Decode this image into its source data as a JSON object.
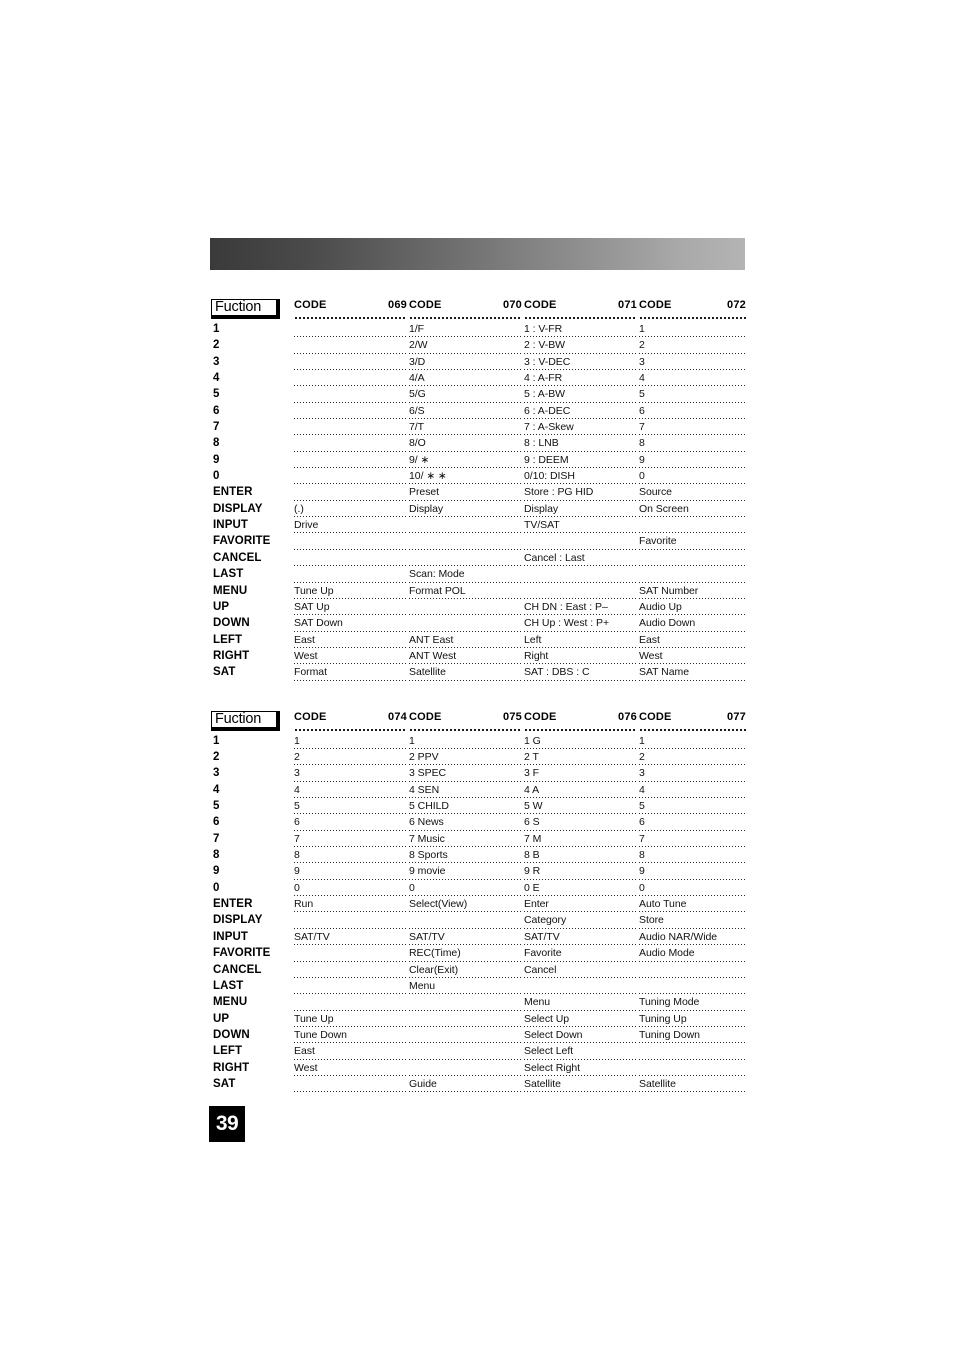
{
  "page": {
    "number": "39"
  },
  "banner": {
    "gradient_from": "#3a3a3a",
    "gradient_to": "#b4b4b4"
  },
  "tables": [
    {
      "fuction_label": "Fuction",
      "code_label": "CODE",
      "codes": [
        "069",
        "070",
        "071",
        "072"
      ],
      "functions": [
        "1",
        "2",
        "3",
        "4",
        "5",
        "6",
        "7",
        "8",
        "9",
        "0",
        "ENTER",
        "DISPLAY",
        "INPUT",
        "FAVORITE",
        "CANCEL",
        "LAST",
        "MENU",
        "UP",
        "DOWN",
        "LEFT",
        "RIGHT",
        "SAT"
      ],
      "columns": [
        [
          "",
          "",
          "",
          "",
          "",
          "",
          "",
          "",
          "",
          "",
          "",
          "(.)",
          "Drive",
          "",
          "",
          "",
          "Tune Up",
          "SAT Up",
          "SAT Down",
          "East",
          "West",
          "Format"
        ],
        [
          "1/F",
          "2/W",
          "3/D",
          "4/A",
          "5/G",
          "6/S",
          "7/T",
          "8/O",
          "9/ ∗",
          "10/ ∗ ∗",
          "Preset",
          "Display",
          "",
          "",
          "",
          "Scan: Mode",
          "Format POL",
          "",
          "",
          "ANT East",
          "ANT West",
          "Satellite"
        ],
        [
          "1 : V-FR",
          "2 : V-BW",
          "3 : V-DEC",
          "4 : A-FR",
          "5 : A-BW",
          "6 : A-DEC",
          "7 : A-Skew",
          "8 : LNB",
          "9 : DEEM",
          "0/10: DISH",
          "Store : PG HID",
          "Display",
          "TV/SAT",
          "",
          "Cancel : Last",
          "",
          "",
          "CH DN : East : P–",
          "CH Up : West : P+",
          "Left",
          "Right",
          "SAT : DBS : C"
        ],
        [
          "1",
          "2",
          "3",
          "4",
          "5",
          "6",
          "7",
          "8",
          "9",
          "0",
          "Source",
          "On Screen",
          "",
          "Favorite",
          "",
          "",
          "SAT Number",
          "Audio Up",
          "Audio Down",
          "East",
          "West",
          "SAT Name"
        ]
      ]
    },
    {
      "fuction_label": "Fuction",
      "code_label": "CODE",
      "codes": [
        "074",
        "075",
        "076",
        "077"
      ],
      "functions": [
        "1",
        "2",
        "3",
        "4",
        "5",
        "6",
        "7",
        "8",
        "9",
        "0",
        "ENTER",
        "DISPLAY",
        "INPUT",
        "FAVORITE",
        "CANCEL",
        "LAST",
        "MENU",
        "UP",
        "DOWN",
        "LEFT",
        "RIGHT",
        "SAT"
      ],
      "columns": [
        [
          "1",
          "2",
          "3",
          "4",
          "5",
          "6",
          "7",
          "8",
          "9",
          "0",
          "Run",
          "",
          "SAT/TV",
          "",
          "",
          "",
          "",
          "Tune Up",
          "Tune Down",
          "East",
          "West",
          ""
        ],
        [
          "1",
          "2 PPV",
          "3 SPEC",
          "4 SEN",
          "5 CHILD",
          "6 News",
          "7 Music",
          "8 Sports",
          "9 movie",
          "0",
          "Select(View)",
          "",
          "SAT/TV",
          "REC(Time)",
          "Clear(Exit)",
          "Menu",
          "",
          "",
          "",
          "",
          "",
          "Guide"
        ],
        [
          "1 G",
          "2 T",
          "3 F",
          "4 A",
          "5 W",
          "6 S",
          "7 M",
          "8 B",
          "9 R",
          "0 E",
          "Enter",
          "Category",
          "SAT/TV",
          "Favorite",
          "Cancel",
          "",
          "Menu",
          "Select Up",
          "Select Down",
          "Select Left",
          "Select Right",
          "Satellite"
        ],
        [
          "1",
          "2",
          "3",
          "4",
          "5",
          "6",
          "7",
          "8",
          "9",
          "0",
          "Auto Tune",
          "Store",
          "Audio NAR/Wide",
          "Audio Mode",
          "",
          "",
          "Tuning Mode",
          "Tuning Up",
          "Tuning Down",
          "",
          "",
          "Satellite"
        ]
      ]
    }
  ]
}
